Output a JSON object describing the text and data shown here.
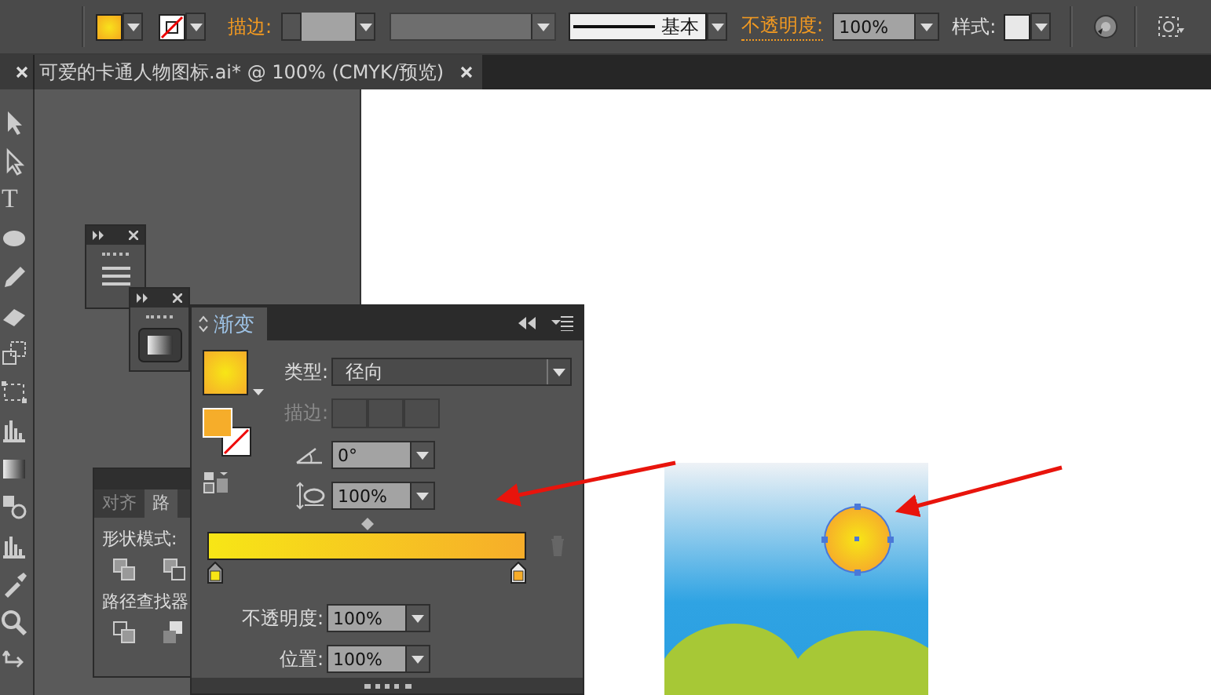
{
  "control_bar": {
    "stroke_label": "描边:",
    "stroke_profile": "基本",
    "opacity_label": "不透明度:",
    "opacity": "100%",
    "style_label": "样式:"
  },
  "document_tab": {
    "title": "可爱的卡通人物图标.ai* @ 100% (CMYK/预览)",
    "selected": true
  },
  "tools": [
    {
      "kind": "selection"
    },
    {
      "kind": "direct-selection"
    },
    {
      "kind": "type",
      "glyph": "T"
    },
    {
      "kind": "ellipse"
    },
    {
      "kind": "pencil"
    },
    {
      "kind": "eraser"
    },
    {
      "kind": "scale"
    },
    {
      "kind": "free-transform"
    },
    {
      "kind": "graph"
    },
    {
      "kind": "gradient"
    },
    {
      "kind": "blend"
    },
    {
      "kind": "graph"
    },
    {
      "kind": "eyedropper"
    },
    {
      "kind": "zoom"
    },
    {
      "kind": "swap"
    }
  ],
  "pathfinder_panel": {
    "tabs": [
      {
        "label": "对齐",
        "selected": false
      },
      {
        "label": "路",
        "selected": true
      }
    ],
    "shape_modes_label": "形状模式:",
    "pathfinders_label": "路径查找器"
  },
  "gradient_panel": {
    "title": "渐变",
    "type_label": "类型:",
    "type_value": "径向",
    "stroke_label": "描边:",
    "stroke_disabled": true,
    "angle": "0°",
    "aspect_ratio": "100%",
    "stops": [
      {
        "color": "#f7e616",
        "selected": false
      },
      {
        "color": "#f6ad2a",
        "selected": true
      }
    ],
    "opacity_label": "不透明度:",
    "opacity": "100%",
    "location_label": "位置:",
    "location": "100%"
  }
}
